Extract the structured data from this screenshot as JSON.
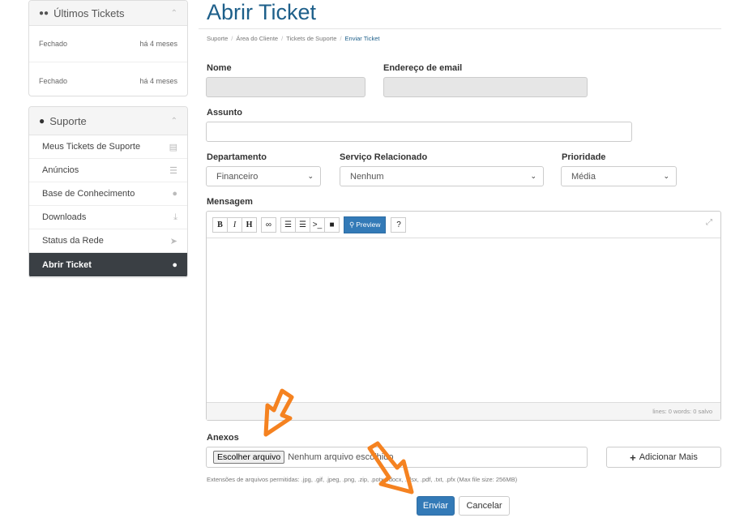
{
  "sidebar": {
    "recent_tickets": {
      "title": "Últimos Tickets",
      "items": [
        {
          "status": "Fechado",
          "time": "há 4 meses"
        },
        {
          "status": "Fechado",
          "time": "há 4 meses"
        }
      ]
    },
    "support": {
      "title": "Suporte",
      "items": [
        {
          "label": "Meus Tickets de Suporte",
          "icon": "ticket-icon"
        },
        {
          "label": "Anúncios",
          "icon": "list-icon"
        },
        {
          "label": "Base de Conhecimento",
          "icon": "info-icon"
        },
        {
          "label": "Downloads",
          "icon": "download-icon"
        },
        {
          "label": "Status da Rede",
          "icon": "rocket-icon"
        },
        {
          "label": "Abrir Ticket",
          "icon": "comments-icon",
          "active": true
        }
      ]
    }
  },
  "page": {
    "title": "Abrir Ticket",
    "breadcrumb": [
      "Suporte",
      "Área do Cliente",
      "Tickets de Suporte",
      "Enviar Ticket"
    ]
  },
  "form": {
    "name_label": "Nome",
    "email_label": "Endereço de email",
    "subject_label": "Assunto",
    "department_label": "Departamento",
    "department_value": "Financeiro",
    "service_label": "Serviço Relacionado",
    "service_value": "Nenhum",
    "priority_label": "Prioridade",
    "priority_value": "Média",
    "message_label": "Mensagem",
    "editor": {
      "preview_label": "Preview",
      "status": "lines: 0  words: 0  salvo"
    },
    "attachments_label": "Anexos",
    "file_button": "Escolher arquivo",
    "file_status": "Nenhum arquivo escolhido",
    "add_more": "Adicionar Mais",
    "extensions_text": "Extensões de arquivos permitidas: .jpg, .gif, .jpeg, .png, .zip, .potx, .docx, .xlsx, .pdf, .txt, .pfx (Max file size: 256MB)",
    "submit": "Enviar",
    "cancel": "Cancelar"
  },
  "colors": {
    "primary": "#337ab7",
    "title": "#1d5f8a",
    "sidebar_active": "#3a3f44",
    "annotation_arrow": "#f58220"
  }
}
